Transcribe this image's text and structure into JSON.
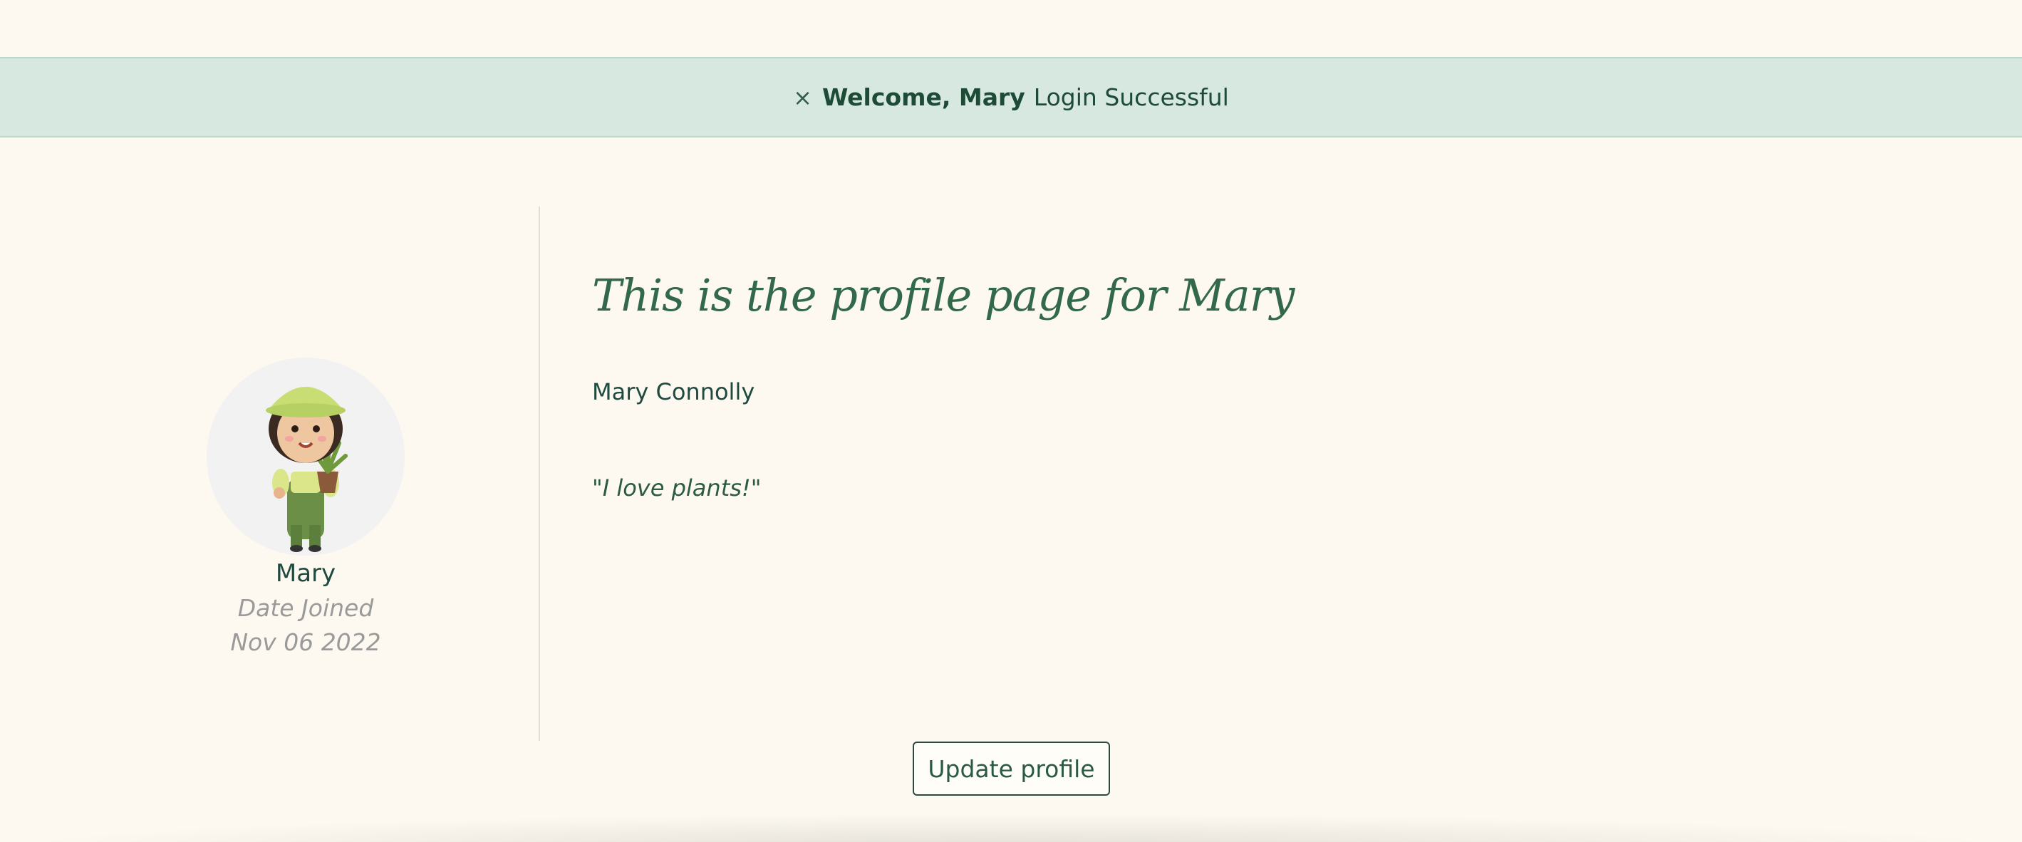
{
  "alert": {
    "close_symbol": "×",
    "welcome": "Welcome, Mary",
    "message": "Login Successful",
    "background_color": "#d6e8df"
  },
  "sidebar": {
    "avatar_icon": "gardener-avatar-icon",
    "username": "Mary",
    "joined_label": "Date Joined",
    "joined_date": "Nov 06 2022"
  },
  "main": {
    "title": "This is the profile page for Mary",
    "full_name": "Mary Connolly",
    "bio": "\"I love plants!\""
  },
  "actions": {
    "update_label": "Update profile"
  },
  "colors": {
    "page_background": "#fdf9f0",
    "accent_green": "#33694b",
    "text_dark": "#1f4a40",
    "muted": "#9a9a9a"
  }
}
